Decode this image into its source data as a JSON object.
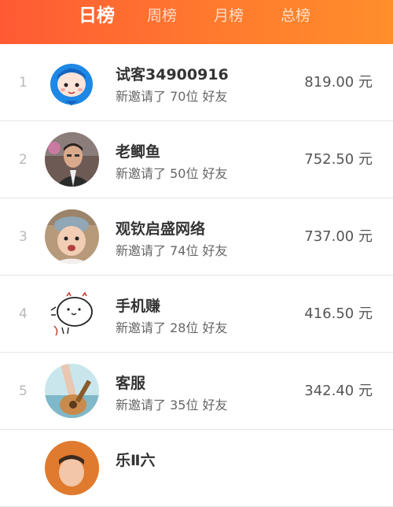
{
  "tabs": [
    {
      "label": "日榜",
      "active": true
    },
    {
      "label": "周榜",
      "active": false
    },
    {
      "label": "月榜",
      "active": false
    },
    {
      "label": "总榜",
      "active": false
    }
  ],
  "rows": [
    {
      "rank": "1",
      "name": "试客34900916",
      "invited": "新邀请了 70位 好友",
      "amount": "819.00 元",
      "avatar": "blue-hood-cartoon-avatar"
    },
    {
      "rank": "2",
      "name": "老鲫鱼",
      "invited": "新邀请了 50位 好友",
      "amount": "752.50 元",
      "avatar": "man-photo-avatar"
    },
    {
      "rank": "3",
      "name": "观钦启盛网络",
      "invited": "新邀请了 74位 好友",
      "amount": "737.00 元",
      "avatar": "child-photo-avatar"
    },
    {
      "rank": "4",
      "name": "手机赚",
      "invited": "新邀请了 28位 好友",
      "amount": "416.50 元",
      "avatar": "sketch-face-avatar"
    },
    {
      "rank": "5",
      "name": "客服",
      "invited": "新邀请了 35位 好友",
      "amount": "342.40 元",
      "avatar": "guitar-photo-avatar"
    },
    {
      "rank": "",
      "name": "乐Ⅱ六",
      "invited": "",
      "amount": "",
      "avatar": "photo-avatar"
    }
  ]
}
